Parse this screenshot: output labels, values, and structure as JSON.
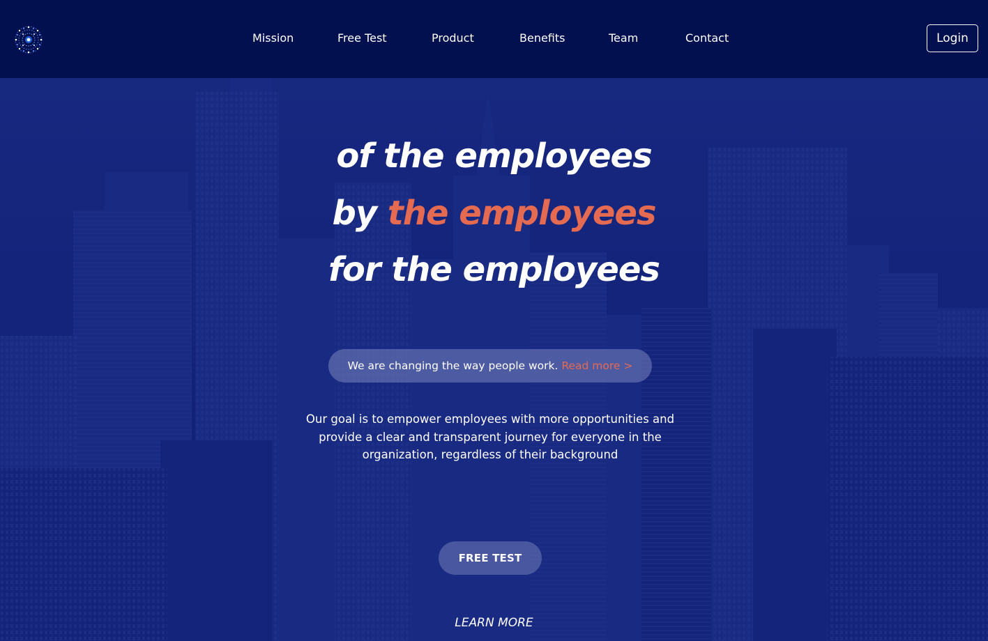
{
  "nav": {
    "logo": "globe-network-logo",
    "items": [
      {
        "label": "Mission"
      },
      {
        "label": "Free Test"
      },
      {
        "label": "Product"
      },
      {
        "label": "Benefits"
      },
      {
        "label": "Team"
      },
      {
        "label": "Contact"
      }
    ],
    "login_label": "Login"
  },
  "hero": {
    "headline": {
      "line1": "of the employees",
      "line2_prefix": "by",
      "line2_accent": "the employees",
      "line3": "for the employees"
    },
    "pill": {
      "text": "We are changing the way people work.",
      "link": "Read more >"
    },
    "description": "Our goal is to empower employees with more opportunities and provide a clear and transparent journey for everyone in the organization, regardless of their background",
    "cta_label": "FREE TEST",
    "learn_more_label": "LEARN MORE"
  },
  "colors": {
    "header_bg": "#03104f",
    "hero_bg": "#132378",
    "accent": "#e46a52",
    "text": "#ffffff"
  }
}
